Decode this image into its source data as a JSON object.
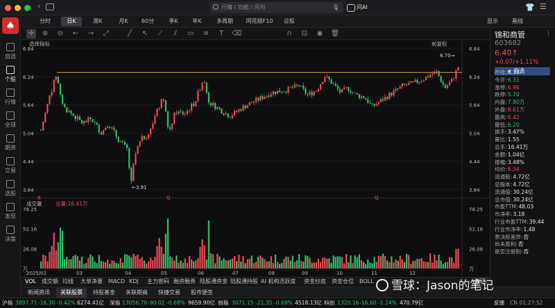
{
  "titlebar": {
    "search_placeholder": "行情 / 功能 / 问句",
    "ai_label": "问AI"
  },
  "sidebar": {
    "items": [
      {
        "label": "自选",
        "icon": "star-icon"
      },
      {
        "label": "个股",
        "icon": "candlestick-icon"
      },
      {
        "label": "行情",
        "icon": "list-icon"
      },
      {
        "label": "全球",
        "icon": "globe-icon"
      },
      {
        "label": "期资",
        "icon": "futures-icon"
      },
      {
        "label": "交易",
        "icon": "trade-icon"
      },
      {
        "label": "选股",
        "icon": "filter-icon"
      },
      {
        "label": "发现",
        "icon": "compass-icon"
      },
      {
        "label": "决策",
        "icon": "decision-icon"
      }
    ],
    "active_index": 1
  },
  "tabs": {
    "items": [
      "分时",
      "日K",
      "周K",
      "月K",
      "60分",
      "季K",
      "年K",
      "多周期",
      "同花顺F10",
      "诊股"
    ],
    "selected_index": 1,
    "right_items": [
      "显示",
      "画线"
    ]
  },
  "chart": {
    "indicator_label": "选择指标",
    "restoration": "前复权",
    "volume_label": "成交量",
    "volume_total": "总量:16.41万",
    "high_marker": "6.70",
    "low_marker": "3.91",
    "marker_b": "B",
    "marker_q": "Q"
  },
  "chart_data": {
    "type": "candlestick",
    "price_axis": {
      "ticks": [
        "6.84",
        "6.24",
        "5.64",
        "5.04",
        "4.44",
        "3.84"
      ],
      "ylim": [
        3.84,
        6.84
      ]
    },
    "volume_axis": {
      "ticks": [
        "78.25",
        "52.16",
        "26.08",
        "万"
      ],
      "ylim": [
        0,
        78.25
      ]
    },
    "x_labels": [
      "2025/02",
      "03",
      "04",
      "05",
      "06",
      "07",
      "08",
      "09",
      "10",
      "11",
      "12"
    ],
    "reference_line": 6.33,
    "period_high": 6.7,
    "period_low": 3.91
  },
  "indicators": [
    "VOL",
    "成交额",
    "均线",
    "大单净量",
    "MACD",
    "KDJ",
    "主力密码",
    "融资融券",
    "陆股通资金",
    "陆股通持股",
    "AI 机构活跃度",
    "资金抄底",
    "资金仓位",
    "BOLL"
  ],
  "indicator_more": "筹码",
  "bottom_tabs": {
    "items": [
      "新闻资讯",
      "关联股票",
      "持股基金",
      "关联期商",
      "快捷交易",
      "股市便签"
    ],
    "selected_index": 1
  },
  "stock": {
    "name": "锦和商管",
    "code": "603682",
    "price": "6.40",
    "change": "+0.07/+1.11%",
    "add_label": "自选"
  },
  "quotes": [
    {
      "k": "昨收:",
      "v": "6.33",
      "c": "white"
    },
    {
      "k": "今开:",
      "v": "6.31",
      "c": "green"
    },
    {
      "k": "涨停:",
      "v": "6.96",
      "c": "red"
    },
    {
      "k": "跌停:",
      "v": "5.70",
      "c": "green"
    },
    {
      "k": "内盘:",
      "v": "7.80万",
      "c": "green"
    },
    {
      "k": "外盘:",
      "v": "8.61万",
      "c": "red"
    },
    {
      "k": "最高:",
      "v": "6.42",
      "c": "red"
    },
    {
      "k": "最低:",
      "v": "6.20",
      "c": "green"
    },
    {
      "k": "换手:",
      "v": "3.47%",
      "c": "white"
    },
    {
      "k": "量比:",
      "v": "1.55",
      "c": "white"
    },
    {
      "k": "总手:",
      "v": "16.41万",
      "c": "white"
    },
    {
      "k": "金额:",
      "v": "1.04亿",
      "c": "white"
    },
    {
      "k": "振幅:",
      "v": "3.48%",
      "c": "white"
    },
    {
      "k": "均价:",
      "v": "6.34",
      "c": "red"
    },
    {
      "k": "流通股:",
      "v": "4.72亿",
      "c": "white"
    },
    {
      "k": "总股本:",
      "v": "4.72亿",
      "c": "white"
    },
    {
      "k": "流通值:",
      "v": "30.24亿",
      "c": "white"
    },
    {
      "k": "总市值:",
      "v": "30.24亿",
      "c": "white"
    },
    {
      "k": "市盈TTM:",
      "v": "48.03",
      "c": "white"
    },
    {
      "k": "市净率:",
      "v": "3.18",
      "c": "white"
    },
    {
      "k": "行业市盈TTM:",
      "v": "39.44",
      "c": "white"
    },
    {
      "k": "行业市净率:",
      "v": "1.48",
      "c": "white"
    },
    {
      "k": "表决权差异:",
      "v": "否",
      "c": "white"
    },
    {
      "k": "尚未盈利:",
      "v": "否",
      "c": "white"
    },
    {
      "k": "是否注册制:",
      "v": "否",
      "c": "white"
    }
  ],
  "status": {
    "hu_label": "沪指",
    "hu_val": "3897.71",
    "hu_chg": "-16.30",
    "hu_pct": "-0.42%",
    "hu_amt": "6274.41亿",
    "sz_label": "深指",
    "sz_val": "13056.70",
    "sz_chg": "-90.02",
    "sz_pct": "-0.68%",
    "sz_amt": "9659.90亿",
    "cy_label": "创指",
    "cy_val": "3071.15",
    "cy_chg": "-21.35",
    "cy_pct": "-0.69%",
    "cy_amt": "4518.13亿",
    "kc_label": "科创",
    "kc_val": "1320.16",
    "kc_chg": "-16.60",
    "kc_pct": "-1.24%",
    "kc_amt": "470.79亿",
    "feedback": "反馈",
    "time": "CN 01:27:52"
  },
  "watermark": "雪球：Jason的笔记",
  "colors": {
    "up": "#f24957",
    "down": "#2fc26b",
    "ma": "#e0a43a",
    "accent": "#2d4f86"
  }
}
